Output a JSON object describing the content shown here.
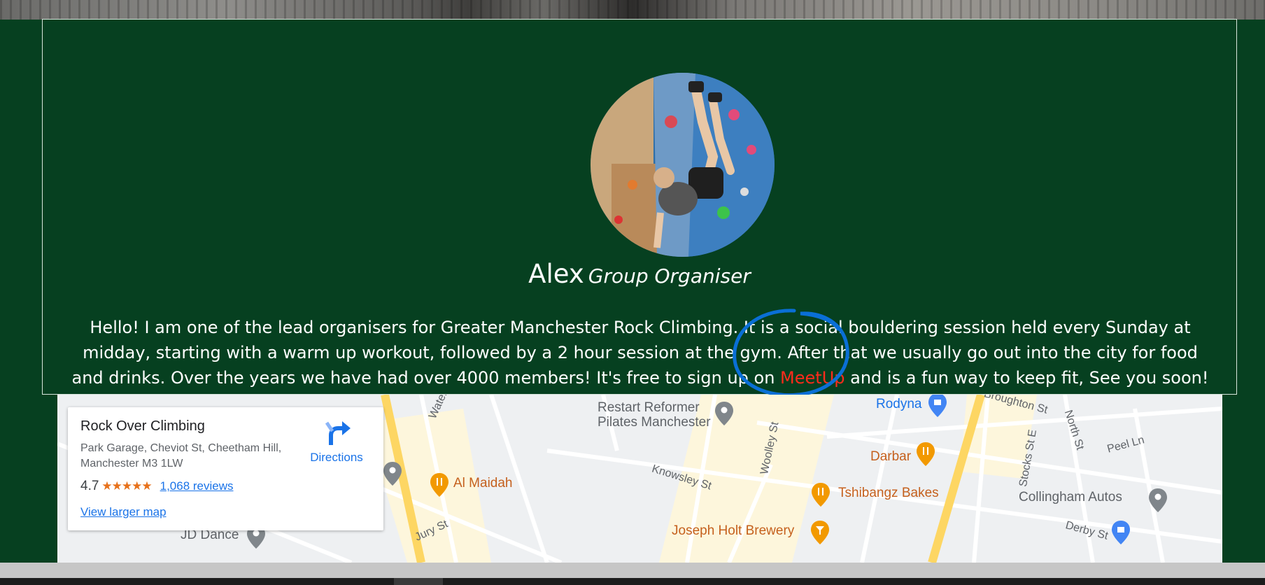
{
  "profile": {
    "name": "Alex",
    "role": "Group Organiser",
    "bio_before": "Hello! I am one of the lead organisers for Greater Manchester Rock Climbing. It is a social bouldering session held every Sunday at midday, starting with a warm up workout, followed by a 2 hour session at the gym. After that we usually go out into the city for food and drinks. Over the years we have had over 4000 members! It's free to sign up on ",
    "meetup_link": "MeetUp",
    "bio_after": " and is a fun way to keep fit, See you soon!"
  },
  "map_card": {
    "place_name": "Rock Over Climbing",
    "address": "Park Garage, Cheviot St, Cheetham Hill, Manchester M3 1LW",
    "rating": "4.7",
    "stars": "★★★★★",
    "reviews": "1,068 reviews",
    "directions": "Directions",
    "view_larger_map": "View larger map"
  },
  "map_places": {
    "restart_reformer": "Restart Reformer",
    "pilates_manchester": "Pilates Manchester",
    "rodyna": "Rodyna",
    "darbar": "Darbar",
    "al_maidah": "Al Maidah",
    "tshibangz": "Tshibangz Bakes",
    "joseph_holt": "Joseph Holt Brewery",
    "collingham": "Collingham Autos",
    "jd_dance": "JD Dance"
  },
  "streets": {
    "waterloo": "Waterloo R",
    "woolley": "Woolley St",
    "broughton": "Broughton St",
    "north": "North St",
    "peel": "Peel Ln",
    "stocks": "Stocks St E",
    "knowsley": "Knowsley St",
    "jury": "Jury St",
    "derby": "Derby St"
  },
  "colors": {
    "page_bg": "#064020",
    "meetup": "#ff2b1c",
    "annotation": "#0a6fd6",
    "link": "#1a73e8",
    "poi_orange": "#c5601d"
  }
}
